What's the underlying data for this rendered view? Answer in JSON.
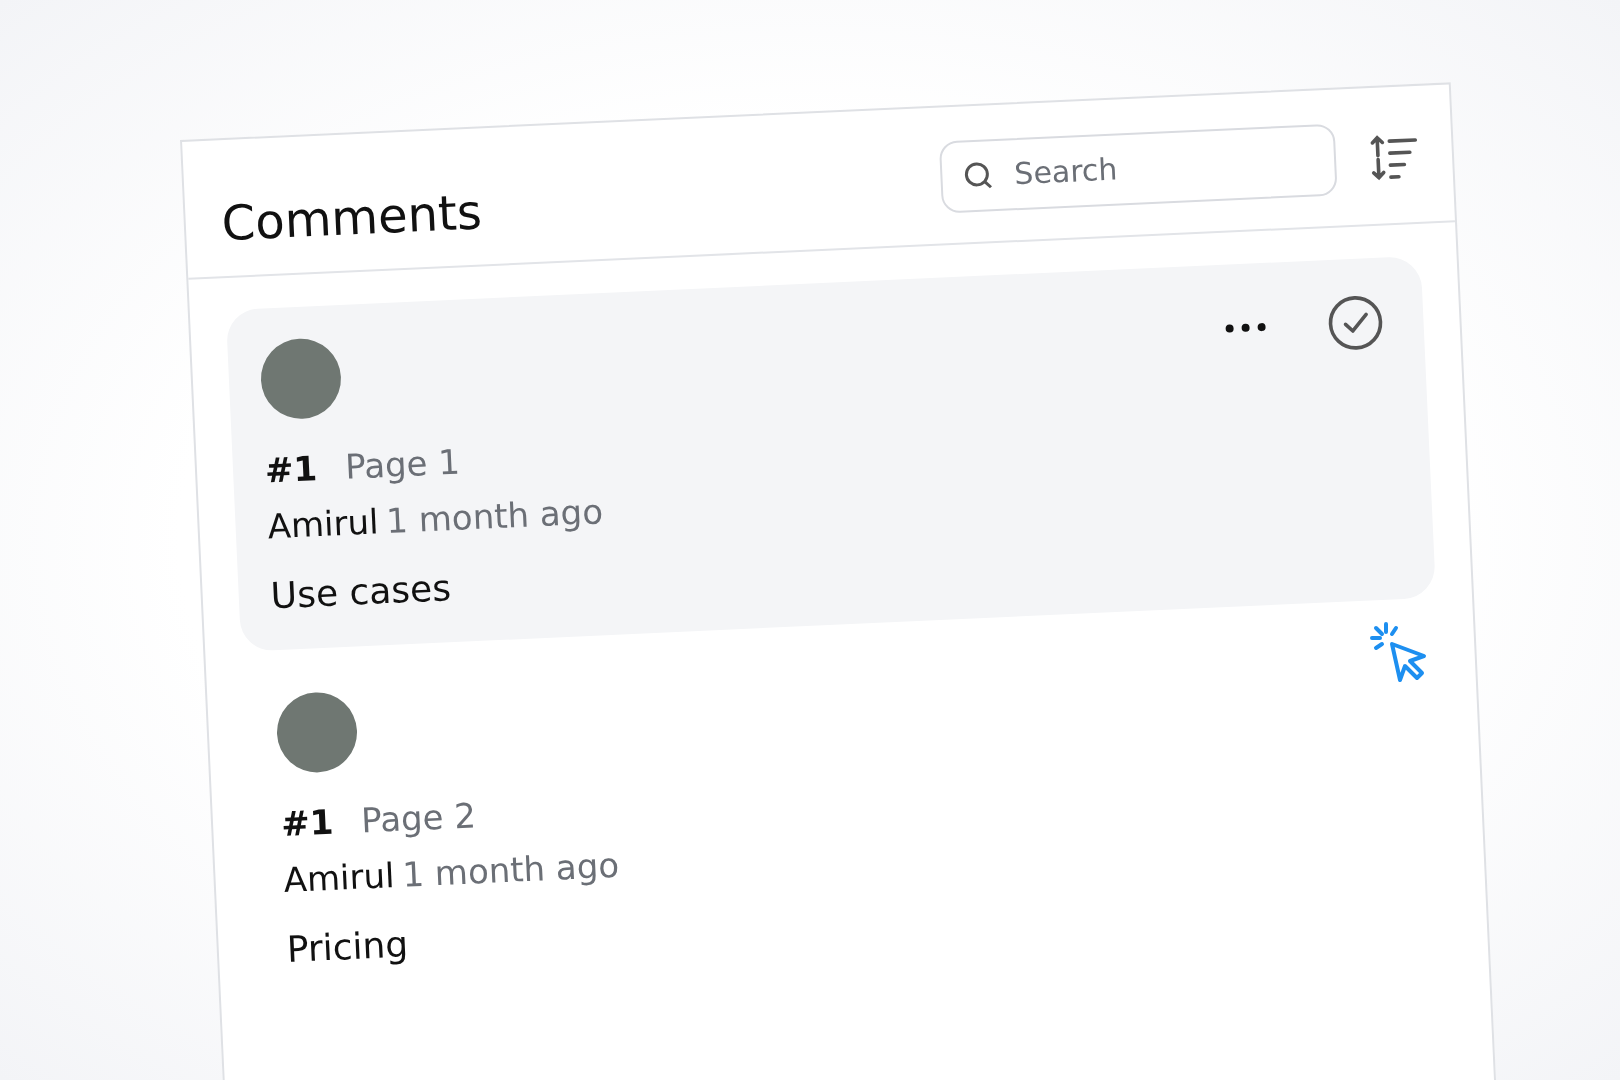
{
  "panel": {
    "title": "Comments",
    "search": {
      "placeholder": "Search"
    }
  },
  "comments": [
    {
      "number": "#1",
      "page": "Page 1",
      "author": "Amirul",
      "time": "1 month ago",
      "text": "Use cases",
      "highlighted": true
    },
    {
      "number": "#1",
      "page": "Page 2",
      "author": "Amirul",
      "time": "1 month ago",
      "text": "Pricing",
      "highlighted": false
    }
  ]
}
